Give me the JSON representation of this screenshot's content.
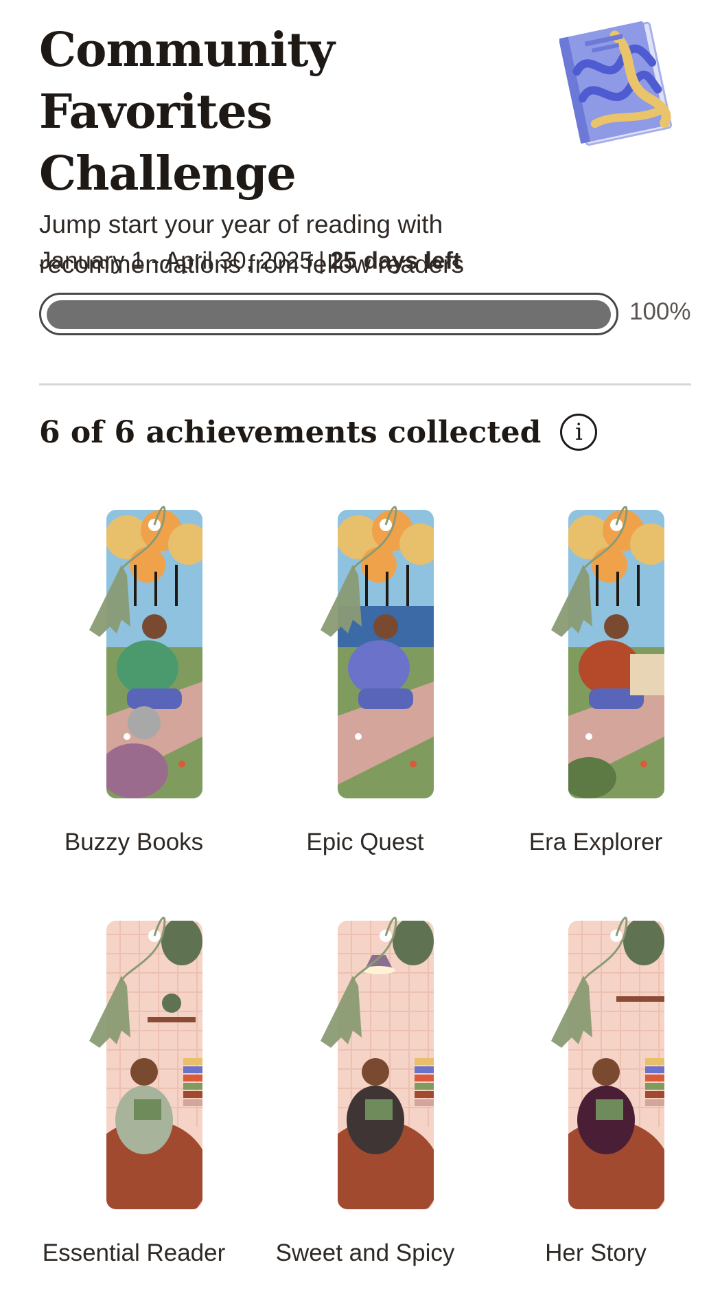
{
  "challenge": {
    "title_line1": "Community Favorites",
    "title_line2": "Challenge",
    "subtitle_line1": "Jump start your year of reading with",
    "subtitle_line2": "recommendations from fellow readers",
    "date_range": "January 1 - April 30, 2025",
    "separator": "|",
    "days_left": "25 days left",
    "progress_value": 1.0,
    "progress_label": "100%",
    "badge_icon": "book-badge-icon"
  },
  "achievements": {
    "heading": "6 of 6 achievements collected",
    "info_icon": "info-icon",
    "info_glyph": "i",
    "items": [
      {
        "label": "Buzzy Books",
        "theme": "park",
        "accent": "#4a9a6e"
      },
      {
        "label": "Epic Quest",
        "theme": "lake",
        "accent": "#6b72c9"
      },
      {
        "label": "Era Explorer",
        "theme": "bench",
        "accent": "#b44a2a"
      },
      {
        "label": "Essential Reader",
        "theme": "room",
        "accent": "#a7b39a"
      },
      {
        "label": "Sweet and Spicy",
        "theme": "lamp",
        "accent": "#3f3535"
      },
      {
        "label": "Her Story",
        "theme": "chair",
        "accent": "#4a1e35"
      }
    ]
  },
  "colors": {
    "text": "#1e1915",
    "progress_fill": "#707070",
    "divider": "#d9d6d3",
    "tassel": "#8a9b74"
  }
}
